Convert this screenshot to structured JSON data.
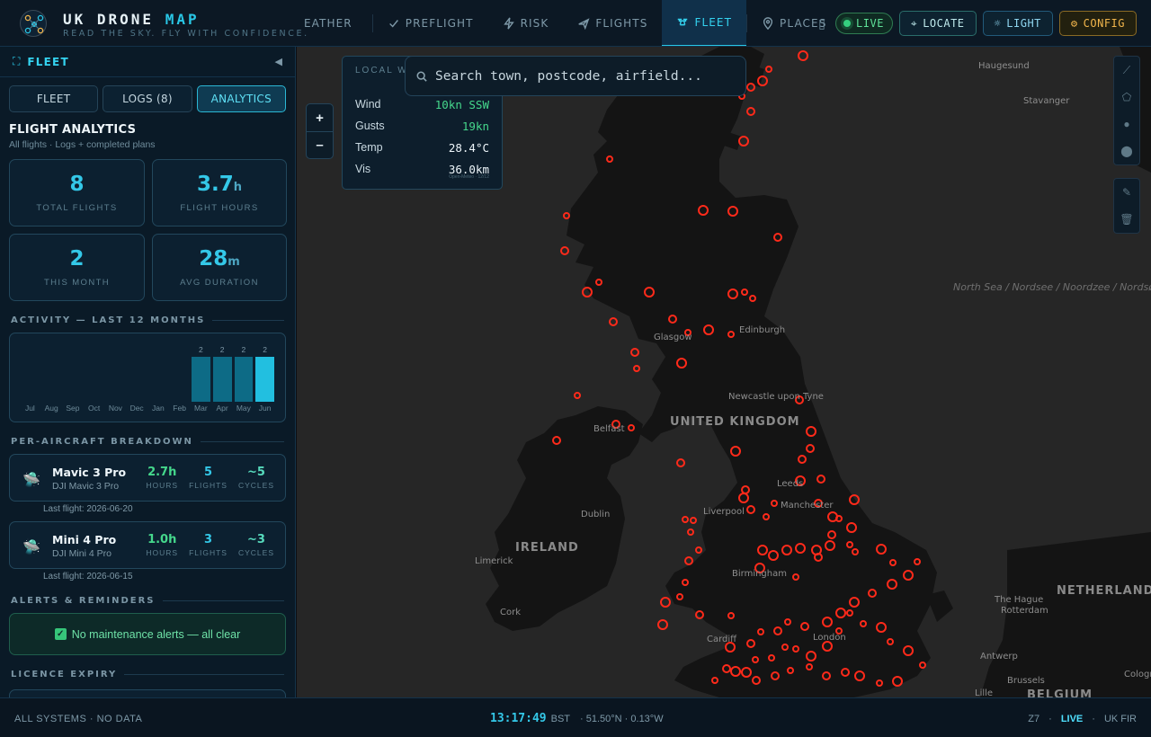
{
  "brand": {
    "title_main": "UK DRONE ",
    "title_accent": "MAP",
    "tagline": "READ THE SKY. FLY WITH CONFIDENCE."
  },
  "nav": {
    "items": [
      {
        "label": "EATHER",
        "icon": "cloud-icon"
      },
      {
        "label": "PREFLIGHT",
        "icon": "check-icon"
      },
      {
        "label": "RISK",
        "icon": "lightning-icon"
      },
      {
        "label": "FLIGHTS",
        "icon": "plane-icon"
      },
      {
        "label": "FLEET",
        "icon": "drone-icon",
        "active": true
      },
      {
        "label": "PLACES",
        "icon": "pin-icon"
      }
    ]
  },
  "toolbar": {
    "live": "LIVE",
    "locate": "LOCATE",
    "light": "LIGHT",
    "config": "CONFIG"
  },
  "sidebar": {
    "header": "FLEET",
    "tabs": [
      "FLEET",
      "LOGS (8)",
      "ANALYTICS"
    ],
    "active_tab": "ANALYTICS",
    "analytics_title": "FLIGHT ANALYTICS",
    "analytics_sub": "All flights · Logs + completed plans",
    "stats": [
      {
        "value": "8",
        "unit": "",
        "label": "TOTAL FLIGHTS"
      },
      {
        "value": "3.7",
        "unit": "h",
        "label": "FLIGHT HOURS"
      },
      {
        "value": "2",
        "unit": "",
        "label": "THIS MONTH"
      },
      {
        "value": "28",
        "unit": "m",
        "label": "AVG DURATION"
      }
    ],
    "activity_title": "ACTIVITY — LAST 12 MONTHS",
    "activity": {
      "months": [
        "Jul",
        "Aug",
        "Sep",
        "Oct",
        "Nov",
        "Dec",
        "Jan",
        "Feb",
        "Mar",
        "Apr",
        "May",
        "Jun"
      ],
      "counts": [
        0,
        0,
        0,
        0,
        0,
        0,
        0,
        0,
        2,
        2,
        2,
        2
      ],
      "current_month": "Jun"
    },
    "breakdown_title": "PER-AIRCRAFT BREAKDOWN",
    "aircraft": [
      {
        "name": "Mavic 3 Pro",
        "model": "DJI Mavic 3 Pro",
        "hours": "2.7h",
        "flights": "5",
        "cycles": "~5",
        "last_flight": "Last flight: 2026-06-20"
      },
      {
        "name": "Mini 4 Pro",
        "model": "DJI Mini 4 Pro",
        "hours": "1.0h",
        "flights": "3",
        "cycles": "~3",
        "last_flight": "Last flight: 2026-06-15"
      }
    ],
    "metric_labels": {
      "hours": "HOURS",
      "flights": "FLIGHTS",
      "cycles": "CYCLES"
    },
    "alerts_title": "ALERTS & REMINDERS",
    "alert_ok": "No maintenance alerts — all clear",
    "licence_title": "LICENCE EXPIRY"
  },
  "map": {
    "zoom_in": "+",
    "zoom_out": "–",
    "weather": {
      "header": "LOCAL W",
      "rows": [
        {
          "label": "Wind",
          "value": "10kn SSW"
        },
        {
          "label": "Gusts",
          "value": "19kn"
        },
        {
          "label": "Temp",
          "value": "28.4°C"
        },
        {
          "label": "Vis",
          "value": "36.0km"
        }
      ],
      "attribution": "Open-Meteo · 12/12"
    },
    "search": {
      "placeholder": "Search town, postcode, airfield..."
    },
    "labels": {
      "uk": "UNITED KINGDOM",
      "ireland": "IRELAND",
      "netherlands": "NETHERLANDS",
      "belgium": "BELGIUM",
      "north_sea": "North Sea / Nordsee / Noordzee / Nordsøen / Nordsjøen / Mer du Nord",
      "cities": [
        "Haugesund",
        "Stavanger",
        "Edinburgh",
        "Glasgow",
        "Newcastle upon Tyne",
        "Belfast",
        "Leeds",
        "Manchester",
        "Liverpool",
        "Dublin",
        "Birmingham",
        "Limerick",
        "Cork",
        "Cardiff",
        "London",
        "The Hague",
        "Rotterdam",
        "Antwerp",
        "Brussels",
        "Lille",
        "Cologne"
      ]
    },
    "colors": {
      "restricted_zone": "#ff2a1a",
      "land": "#141414",
      "sea": "#262626"
    }
  },
  "statusbar": {
    "systems": "ALL SYSTEMS · NO DATA",
    "time": "13:17:49",
    "tz": "BST",
    "coords": "·   51.50°N · 0.13°W",
    "zoom": "Z7",
    "live": "LIVE",
    "fir": "UK FIR"
  }
}
